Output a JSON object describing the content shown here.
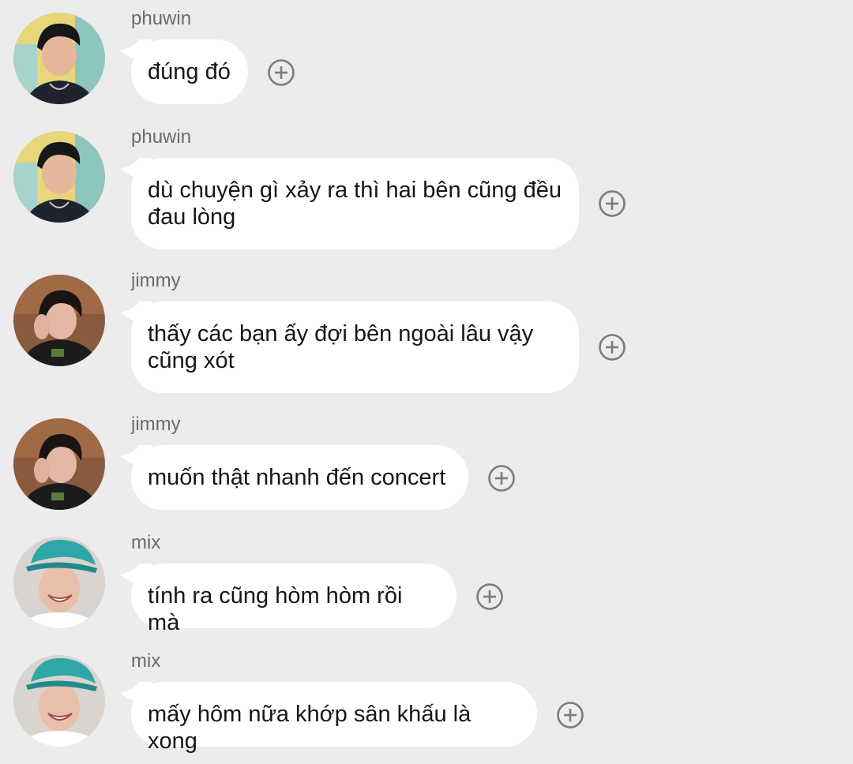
{
  "colors": {
    "background": "#ececec",
    "bubble": "#ffffff",
    "text": "#161616",
    "sender": "#6b6b6b",
    "icon": "#7c7c7c"
  },
  "messages": [
    {
      "sender": "phuwin",
      "text": "đúng đó",
      "avatar": "phuwin-avatar"
    },
    {
      "sender": "phuwin",
      "text": "dù chuyện gì xảy ra thì hai bên cũng đều đau lòng",
      "avatar": "phuwin-avatar"
    },
    {
      "sender": "jimmy",
      "text": "thấy các bạn ấy đợi bên ngoài lâu vậy cũng xót",
      "avatar": "jimmy-avatar"
    },
    {
      "sender": "jimmy",
      "text": "muốn thật nhanh đến concert",
      "avatar": "jimmy-avatar"
    },
    {
      "sender": "mix",
      "text": "tính ra cũng hòm hòm rồi mà",
      "avatar": "mix-avatar"
    },
    {
      "sender": "mix",
      "text": "mấy hôm nữa khớp sân khấu là xong",
      "avatar": "mix-avatar"
    }
  ],
  "icons": {
    "add_reaction": "plus-circle-icon"
  }
}
